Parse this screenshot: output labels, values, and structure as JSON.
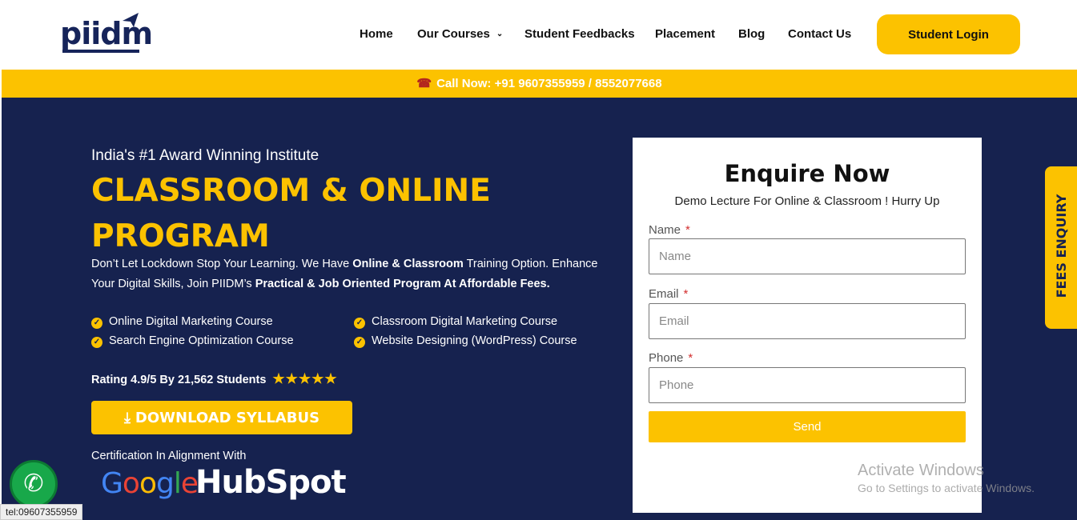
{
  "header": {
    "logo_text": "piidm",
    "nav": [
      {
        "label": "Home"
      },
      {
        "label": "Our Courses"
      },
      {
        "label": "Student Feedbacks"
      },
      {
        "label": "Placement"
      },
      {
        "label": "Blog"
      },
      {
        "label": "Contact Us"
      }
    ],
    "login_label": "Student Login"
  },
  "callbar": {
    "label": "Call Now: ",
    "numbers": "+91 9607355959 / 8552077668"
  },
  "hero": {
    "tagline": "India's #1 Award Winning Institute",
    "headline": "CLASSROOM & ONLINE PROGRAM",
    "desc_1": "Don’t Let Lockdown Stop Your Learning. We Have ",
    "desc_2": "Online & Classroom",
    "desc_3": " Training Option. Enhance Your Digital Skills, Join PIIDM’s ",
    "desc_4": "Practical & Job Oriented Program At Affordable Fees.",
    "features": [
      "Online Digital Marketing Course",
      "Search Engine Optimization Course",
      "Classroom Digital Marketing Course",
      "Website Designing (WordPress) Course"
    ],
    "rating": "Rating 4.9/5 By 21,562 Students",
    "stars": 5,
    "download_label": "DOWNLOAD SYLLABUS",
    "cert_label": "Certification In Alignment With",
    "partner_1": "Google",
    "partner_2": "HubSpot"
  },
  "form": {
    "title": "Enquire Now",
    "subtitle": "Demo Lecture For Online & Classroom ! Hurry Up",
    "fields": [
      {
        "label": "Name",
        "placeholder": "Name"
      },
      {
        "label": "Email",
        "placeholder": "Email"
      },
      {
        "label": "Phone",
        "placeholder": "Phone"
      }
    ],
    "send_label": "Send"
  },
  "fees_tab": "FEES ENQUIRY",
  "watermark": {
    "line1": "Activate Windows",
    "line2": "Go to Settings to activate Windows."
  },
  "status_url": "tel:09607355959",
  "colors": {
    "accent": "#fcc200",
    "navy": "#16224f"
  }
}
